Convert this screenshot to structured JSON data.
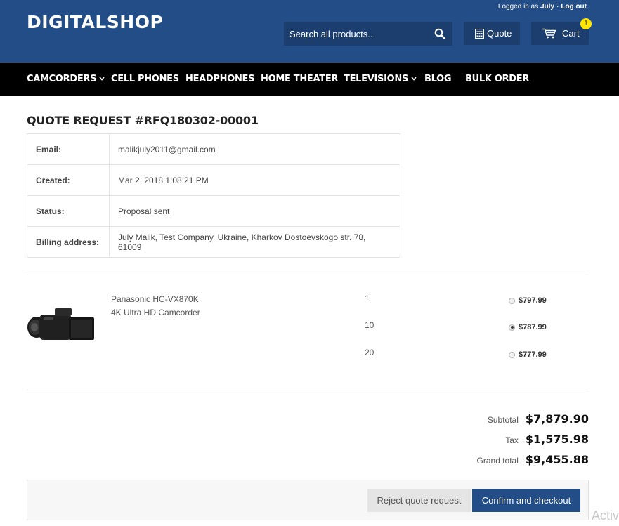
{
  "header": {
    "logo": "DIGITALSHOP",
    "login_prefix": "Logged in as",
    "user": "July",
    "logout_label": "Log out",
    "search_placeholder": "Search all products...",
    "quote_label": "Quote",
    "cart_label": "Cart",
    "cart_count": "1",
    "brand_color": "#234d86",
    "badge_color": "#ffe600"
  },
  "nav": {
    "items": [
      {
        "label": "CAMCORDERS",
        "dropdown": true
      },
      {
        "label": "CELL PHONES",
        "dropdown": false
      },
      {
        "label": "HEADPHONES",
        "dropdown": false
      },
      {
        "label": "HOME THEATER",
        "dropdown": false
      },
      {
        "label": "TELEVISIONS",
        "dropdown": true
      },
      {
        "label": "BLOG",
        "dropdown": false
      },
      {
        "label": "BULK ORDER",
        "dropdown": false
      }
    ]
  },
  "quote": {
    "title": "QUOTE REQUEST #RFQ180302-00001",
    "details": [
      {
        "key": "Email:",
        "value": "malikjuly2011@gmail.com"
      },
      {
        "key": "Created:",
        "value": "Mar 2, 2018 1:08:21 PM"
      },
      {
        "key": "Status:",
        "value": "Proposal sent"
      },
      {
        "key": "Billing address:",
        "value": "July Malik, Test Company, Ukraine, Kharkov Dostoevskogo str. 78, 61009"
      }
    ]
  },
  "product": {
    "name_line1": "Panasonic HC-VX870K",
    "name_line2": "4K Ultra HD Camcorder",
    "image": "camcorder-image",
    "tiers": [
      {
        "qty": "1",
        "price": "$797.99",
        "selected": false
      },
      {
        "qty": "10",
        "price": "$787.99",
        "selected": true
      },
      {
        "qty": "20",
        "price": "$777.99",
        "selected": false
      }
    ]
  },
  "totals": {
    "subtotal_label": "Subtotal",
    "subtotal": "$7,879.90",
    "tax_label": "Tax",
    "tax": "$1,575.98",
    "grand_label": "Grand total",
    "grand": "$9,455.88"
  },
  "actions": {
    "reject_label": "Reject quote request",
    "confirm_label": "Confirm and checkout"
  },
  "overlay_text": "Activ"
}
